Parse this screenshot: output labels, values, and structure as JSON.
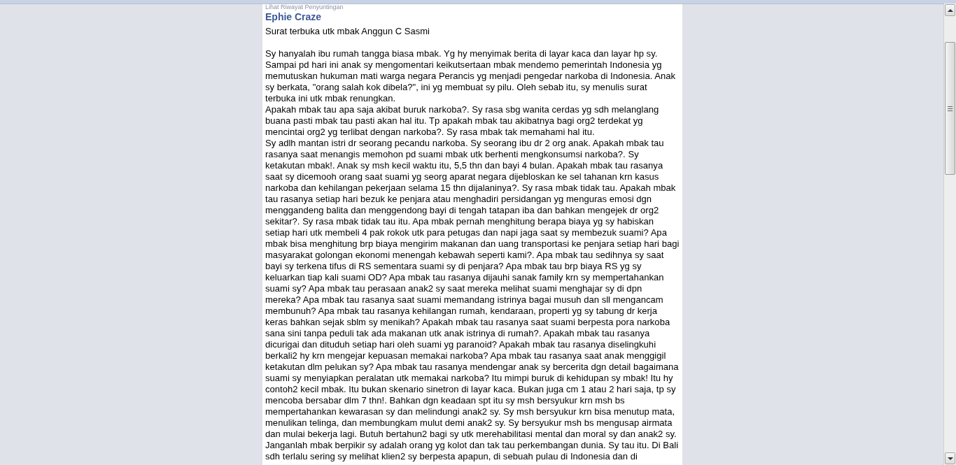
{
  "post": {
    "edit_history_link": "Lihat Riwayat Penyuntingan",
    "author": "Ephie Craze",
    "title": "Surat terbuka utk mbak Anggun C Sasmi",
    "paragraphs": [
      "Sy hanyalah ibu rumah tangga biasa mbak. Yg hy menyimak berita di layar kaca dan layar hp sy. Sampai pd hari ini anak sy mengomentari keikutsertaan mbak mendemo pemerintah Indonesia yg memutuskan hukuman mati warga negara Perancis yg menjadi pengedar narkoba di Indonesia. Anak sy berkata, \"orang salah kok dibela?\", ini yg membuat sy pilu. Oleh sebab itu, sy menulis surat terbuka ini utk mbak renungkan.",
      "Apakah mbak tau apa saja akibat buruk narkoba?. Sy rasa sbg wanita cerdas yg sdh melanglang buana pasti mbak tau pasti akan hal itu. Tp apakah mbak tau akibatnya bagi org2 terdekat yg mencintai org2 yg terlibat dengan narkoba?. Sy rasa mbak tak memahami hal itu.",
      "Sy adlh mantan istri dr seorang pecandu narkoba. Sy seorang ibu dr 2 org anak. Apakah mbak tau rasanya saat menangis memohon pd suami mbak utk berhenti mengkonsumsi narkoba?. Sy ketakutan mbak!. Anak sy msh kecil waktu itu, 5,5 thn dan bayi 4 bulan. Apakah mbak tau rasanya saat sy dicemooh orang saat suami yg seorg aparat negara dijebloskan ke sel tahanan krn kasus narkoba dan kehilangan pekerjaan selama 15 thn dijalaninya?. Sy rasa mbak tidak tau. Apakah mbak tau rasanya setiap hari bezuk ke penjara atau menghadiri persidangan yg menguras emosi dgn menggandeng balita dan menggendong bayi di tengah tatapan iba dan bahkan mengejek dr org2 sekitar?. Sy rasa mbak tidak tau itu. Apa mbak pernah menghitung berapa biaya yg sy habiskan setiap hari utk membeli 4 pak rokok utk para petugas dan napi jaga saat sy membezuk suami? Apa mbak bisa menghitung brp biaya mengirim makanan dan uang transportasi ke penjara setiap hari bagi masyarakat golongan ekonomi menengah kebawah seperti kami?. Apa mbak tau sedihnya sy saat bayi sy terkena tifus di RS sementara suami sy di penjara? Apa mbak tau brp biaya RS yg sy keluarkan tiap kali suami OD? Apa mbak tau rasanya dijauhi sanak family krn sy mempertahankan suami sy? Apa mbak tau perasaan anak2 sy saat mereka melihat suami menghajar sy di dpn mereka? Apa mbak tau rasanya saat suami memandang istrinya bagai musuh dan sll mengancam membunuh? Apa mbak tau rasanya kehilangan rumah, kendaraan, properti yg sy tabung dr kerja keras bahkan sejak sblm sy menikah? Apakah mbak tau rasanya saat suami berpesta pora narkoba sana sini tanpa peduli tak ada makanan utk anak istrinya di rumah?. Apakah mbak tau rasanya dicurigai dan dituduh setiap hari oleh suami yg paranoid? Apakah mbak tau rasanya diselingkuhi berkali2 hy krn mengejar kepuasan memakai narkoba? Apa mbak tau rasanya saat anak menggigil ketakutan dlm pelukan sy? Apa mbak tau rasanya mendengar anak sy bercerita dgn detail bagaimana suami sy menyiapkan peralatan utk memakai narkoba? Itu mimpi buruk di kehidupan sy mbak! Itu hy contoh2 kecil mbak. Itu bukan skenario sinetron di layar kaca. Bukan juga cm 1 atau 2 hari saja, tp sy mencoba bersabar dlm 7 thn!. Bahkan dgn keadaan spt itu sy msh bersyukur krn msh bs mempertahankan kewarasan sy dan melindungi anak2 sy. Sy msh bersyukur krn bisa menutup mata, menulikan telinga, dan membungkam mulut demi anak2 sy. Sy bersyukur msh bs mengusap airmata dan mulai bekerja lagi. Butuh bertahun2 bagi sy utk merehabilitasi mental dan moral sy dan anak2 sy. Janganlah mbak berpikir sy adalah orang yg kolot dan tak tau perkembangan dunia. Sy tau itu. Di Bali sdh terlalu sering sy melihat klien2 sy berpesta apapun, di sebuah pulau di Indonesia dan di"
    ]
  }
}
